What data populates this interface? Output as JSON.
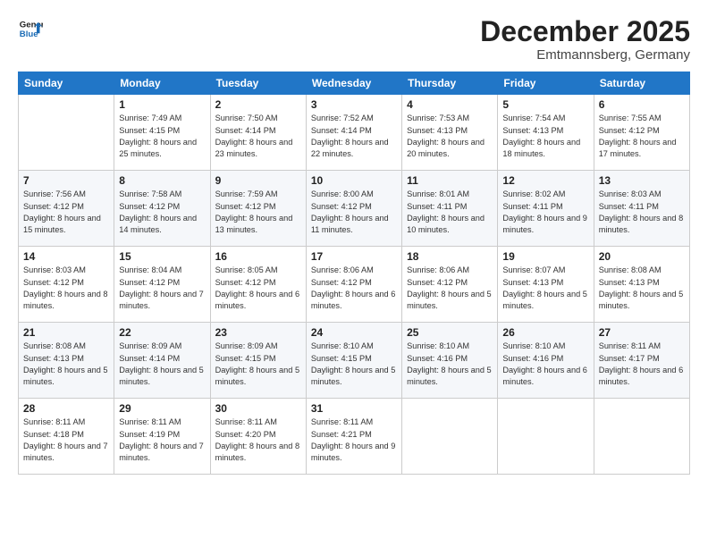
{
  "logo": {
    "line1": "General",
    "line2": "Blue"
  },
  "title": "December 2025",
  "location": "Emtmannsberg, Germany",
  "days_header": [
    "Sunday",
    "Monday",
    "Tuesday",
    "Wednesday",
    "Thursday",
    "Friday",
    "Saturday"
  ],
  "weeks": [
    [
      {
        "day": "",
        "info": ""
      },
      {
        "day": "1",
        "info": "Sunrise: 7:49 AM\nSunset: 4:15 PM\nDaylight: 8 hours\nand 25 minutes."
      },
      {
        "day": "2",
        "info": "Sunrise: 7:50 AM\nSunset: 4:14 PM\nDaylight: 8 hours\nand 23 minutes."
      },
      {
        "day": "3",
        "info": "Sunrise: 7:52 AM\nSunset: 4:14 PM\nDaylight: 8 hours\nand 22 minutes."
      },
      {
        "day": "4",
        "info": "Sunrise: 7:53 AM\nSunset: 4:13 PM\nDaylight: 8 hours\nand 20 minutes."
      },
      {
        "day": "5",
        "info": "Sunrise: 7:54 AM\nSunset: 4:13 PM\nDaylight: 8 hours\nand 18 minutes."
      },
      {
        "day": "6",
        "info": "Sunrise: 7:55 AM\nSunset: 4:12 PM\nDaylight: 8 hours\nand 17 minutes."
      }
    ],
    [
      {
        "day": "7",
        "info": "Sunrise: 7:56 AM\nSunset: 4:12 PM\nDaylight: 8 hours\nand 15 minutes."
      },
      {
        "day": "8",
        "info": "Sunrise: 7:58 AM\nSunset: 4:12 PM\nDaylight: 8 hours\nand 14 minutes."
      },
      {
        "day": "9",
        "info": "Sunrise: 7:59 AM\nSunset: 4:12 PM\nDaylight: 8 hours\nand 13 minutes."
      },
      {
        "day": "10",
        "info": "Sunrise: 8:00 AM\nSunset: 4:12 PM\nDaylight: 8 hours\nand 11 minutes."
      },
      {
        "day": "11",
        "info": "Sunrise: 8:01 AM\nSunset: 4:11 PM\nDaylight: 8 hours\nand 10 minutes."
      },
      {
        "day": "12",
        "info": "Sunrise: 8:02 AM\nSunset: 4:11 PM\nDaylight: 8 hours\nand 9 minutes."
      },
      {
        "day": "13",
        "info": "Sunrise: 8:03 AM\nSunset: 4:11 PM\nDaylight: 8 hours\nand 8 minutes."
      }
    ],
    [
      {
        "day": "14",
        "info": "Sunrise: 8:03 AM\nSunset: 4:12 PM\nDaylight: 8 hours\nand 8 minutes."
      },
      {
        "day": "15",
        "info": "Sunrise: 8:04 AM\nSunset: 4:12 PM\nDaylight: 8 hours\nand 7 minutes."
      },
      {
        "day": "16",
        "info": "Sunrise: 8:05 AM\nSunset: 4:12 PM\nDaylight: 8 hours\nand 6 minutes."
      },
      {
        "day": "17",
        "info": "Sunrise: 8:06 AM\nSunset: 4:12 PM\nDaylight: 8 hours\nand 6 minutes."
      },
      {
        "day": "18",
        "info": "Sunrise: 8:06 AM\nSunset: 4:12 PM\nDaylight: 8 hours\nand 5 minutes."
      },
      {
        "day": "19",
        "info": "Sunrise: 8:07 AM\nSunset: 4:13 PM\nDaylight: 8 hours\nand 5 minutes."
      },
      {
        "day": "20",
        "info": "Sunrise: 8:08 AM\nSunset: 4:13 PM\nDaylight: 8 hours\nand 5 minutes."
      }
    ],
    [
      {
        "day": "21",
        "info": "Sunrise: 8:08 AM\nSunset: 4:13 PM\nDaylight: 8 hours\nand 5 minutes."
      },
      {
        "day": "22",
        "info": "Sunrise: 8:09 AM\nSunset: 4:14 PM\nDaylight: 8 hours\nand 5 minutes."
      },
      {
        "day": "23",
        "info": "Sunrise: 8:09 AM\nSunset: 4:15 PM\nDaylight: 8 hours\nand 5 minutes."
      },
      {
        "day": "24",
        "info": "Sunrise: 8:10 AM\nSunset: 4:15 PM\nDaylight: 8 hours\nand 5 minutes."
      },
      {
        "day": "25",
        "info": "Sunrise: 8:10 AM\nSunset: 4:16 PM\nDaylight: 8 hours\nand 5 minutes."
      },
      {
        "day": "26",
        "info": "Sunrise: 8:10 AM\nSunset: 4:16 PM\nDaylight: 8 hours\nand 6 minutes."
      },
      {
        "day": "27",
        "info": "Sunrise: 8:11 AM\nSunset: 4:17 PM\nDaylight: 8 hours\nand 6 minutes."
      }
    ],
    [
      {
        "day": "28",
        "info": "Sunrise: 8:11 AM\nSunset: 4:18 PM\nDaylight: 8 hours\nand 7 minutes."
      },
      {
        "day": "29",
        "info": "Sunrise: 8:11 AM\nSunset: 4:19 PM\nDaylight: 8 hours\nand 7 minutes."
      },
      {
        "day": "30",
        "info": "Sunrise: 8:11 AM\nSunset: 4:20 PM\nDaylight: 8 hours\nand 8 minutes."
      },
      {
        "day": "31",
        "info": "Sunrise: 8:11 AM\nSunset: 4:21 PM\nDaylight: 8 hours\nand 9 minutes."
      },
      {
        "day": "",
        "info": ""
      },
      {
        "day": "",
        "info": ""
      },
      {
        "day": "",
        "info": ""
      }
    ]
  ]
}
